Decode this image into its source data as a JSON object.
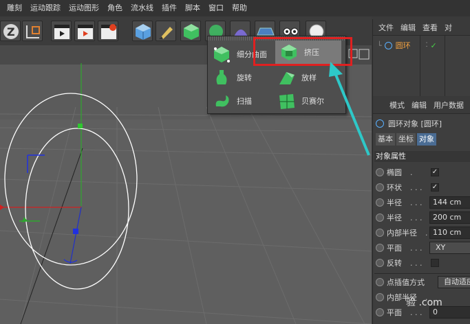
{
  "menubar": {
    "items": [
      "雕刻",
      "运动跟踪",
      "运动图形",
      "角色",
      "流水线",
      "插件",
      "脚本",
      "窗口",
      "帮助"
    ]
  },
  "popup": {
    "items": [
      {
        "label": "细分曲面",
        "icon": "subdivision-surface-icon"
      },
      {
        "label": "挤压",
        "icon": "extrude-icon",
        "selected": true
      },
      {
        "label": "旋转",
        "icon": "lathe-icon"
      },
      {
        "label": "放样",
        "icon": "loft-icon"
      },
      {
        "label": "扫描",
        "icon": "sweep-icon"
      },
      {
        "label": "贝赛尔",
        "icon": "bezier-icon"
      }
    ]
  },
  "object_manager": {
    "tabs": [
      "文件",
      "编辑",
      "查看",
      "对"
    ],
    "object_name": "圆环"
  },
  "attribute_manager": {
    "tabs": [
      "模式",
      "编辑",
      "用户数据"
    ],
    "title": "圆环对象 [圆环]",
    "subtabs": [
      "基本",
      "坐标",
      "对象"
    ],
    "active_subtab": "对象",
    "section_title": "对象属性",
    "props": {
      "ellipse": {
        "label": "椭圆",
        "dots": ".",
        "checked": true
      },
      "ring": {
        "label": "环状",
        "dots": ". . .",
        "checked": true
      },
      "radius1": {
        "label": "半径",
        "dots": ". . .",
        "value": "144 cm"
      },
      "radius2": {
        "label": "半径",
        "dots": ". . .",
        "value": "200 cm"
      },
      "inner_radius": {
        "label": "内部半径",
        "dots": ".",
        "value": "110 cm"
      },
      "plane": {
        "label": "平面",
        "dots": ". . .",
        "value": "XY"
      },
      "reverse": {
        "label": "反转",
        "dots": ". . .",
        "checked": false
      },
      "interpolation": {
        "label": "点插值方式",
        "value": "自动适应"
      },
      "inner_radius2": {
        "label": "内部半径",
        "dots": "."
      },
      "plane2": {
        "label": "平面",
        "dots": ". . .",
        "value": "0"
      }
    }
  },
  "watermark": "验 .com",
  "colors": {
    "highlight": "#e02020",
    "arrow": "#2ec8c8",
    "active_tab": "#4a6c93",
    "axis_y": "#2ea82e",
    "axis_x": "#d02020",
    "axis_z": "#2030c8"
  }
}
